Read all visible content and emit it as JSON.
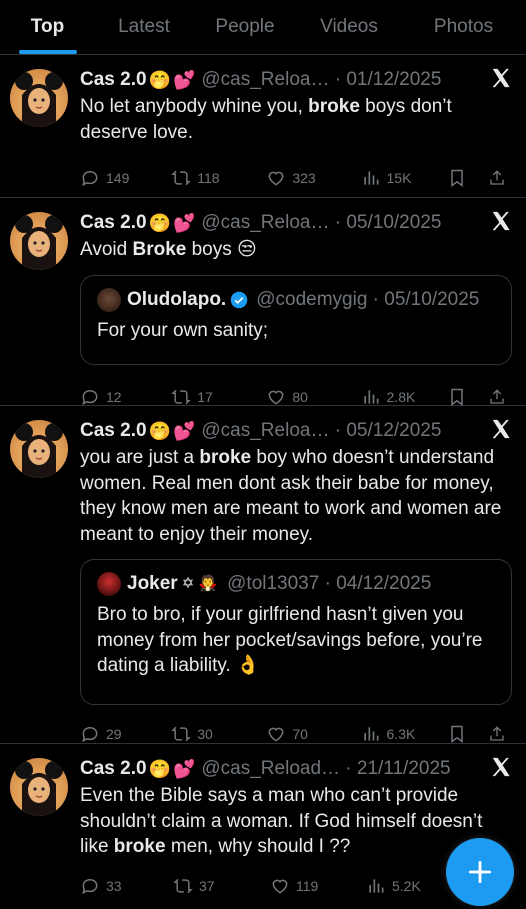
{
  "tabs": [
    "Top",
    "Latest",
    "People",
    "Videos",
    "Photos"
  ],
  "colors": {
    "accent": "#1d9bf0",
    "background": "#000000",
    "muted": "#71767b",
    "text": "#e7e9ea"
  },
  "icons": {
    "reply": "reply-icon",
    "retweet": "retweet-icon",
    "like": "heart-icon",
    "views": "views-icon",
    "bookmark": "bookmark-icon",
    "share": "share-icon",
    "x_logo": "x-logo-icon",
    "compose": "plus-icon"
  },
  "tweets": [
    {
      "name": "Cas 2.0",
      "emoji1": "🤭",
      "emoji2": "💕",
      "handle": "@cas_Reloa… · 01/12/2025",
      "text_parts": [
        "No let anybody whine you, ",
        "broke",
        " boys don’t deserve love."
      ],
      "replies": "149",
      "retweets": "118",
      "likes": "323",
      "views": "15K"
    },
    {
      "name": "Cas 2.0",
      "emoji1": "🤭",
      "emoji2": "💕",
      "handle": "@cas_Reloa… · 05/10/2025",
      "text_parts": [
        "Avoid ",
        "Broke",
        " boys 😒"
      ],
      "quote": {
        "name": "Oludolapo.",
        "handle": "@codemygig · 05/10/2025",
        "text": "For your own sanity;"
      },
      "replies": "12",
      "retweets": "17",
      "likes": "80",
      "views": "2.8K"
    },
    {
      "name": "Cas 2.0",
      "emoji1": "🤭",
      "emoji2": "💕",
      "handle": "@cas_Reloa… · 05/12/2025",
      "text_parts": [
        "you are just a ",
        "broke",
        " boy who doesn’t understand women. Real men dont ask their babe for money, they know men are meant to work and women are meant to enjoy their money."
      ],
      "quote": {
        "name": "Joker",
        "name_emoji": "✡ 🧛",
        "handle": "@tol13037 · 04/12/2025",
        "text": "Bro to bro, if your girlfriend hasn’t given you money from her pocket/savings before, you’re dating a liability. 👌"
      },
      "replies": "29",
      "retweets": "30",
      "likes": "70",
      "views": "6.3K"
    },
    {
      "name": "Cas 2.0",
      "emoji1": "🤭",
      "emoji2": "💕",
      "handle": "@cas_Reload… · 21/11/2025",
      "text_parts": [
        "Even the Bible says a man who can’t provide shouldn’t claim a woman. If God himself doesn’t like ",
        "broke",
        " men, why should I ??"
      ],
      "replies": "33",
      "retweets": "37",
      "likes": "119",
      "views": "5.2K"
    }
  ]
}
